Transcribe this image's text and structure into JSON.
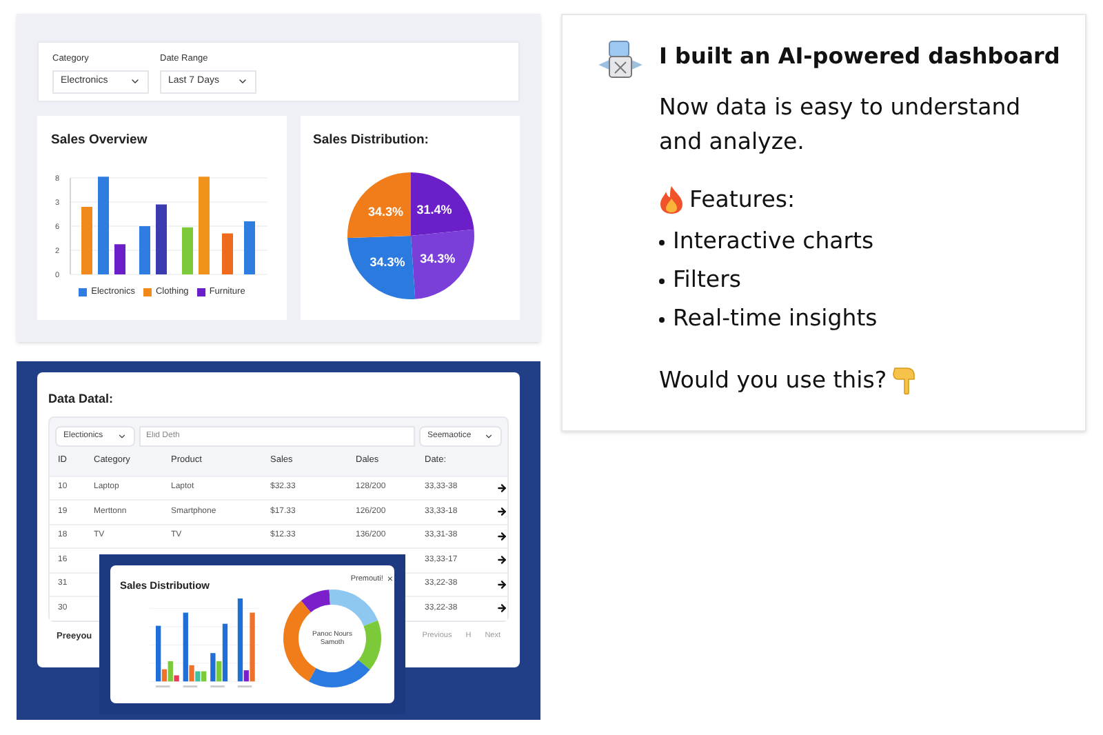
{
  "dashboard": {
    "filters": [
      {
        "label": "Category",
        "value": "Electronics"
      },
      {
        "label": "Date Range",
        "value": "Last 7 Days"
      }
    ],
    "sales_overview": {
      "title": "Sales Overview",
      "axis_labels": [
        "8",
        "3",
        "6",
        "2",
        "0"
      ],
      "legend": [
        {
          "name": "Electronics",
          "color": "#2f7de1"
        },
        {
          "name": "Clothing",
          "color": "#f08a1c"
        },
        {
          "name": "Furniture",
          "color": "#6a1fc9"
        }
      ]
    },
    "sales_distribution": {
      "title": "Sales Distribution:",
      "chart_data": {
        "type": "pie",
        "values": [
          31.4,
          34.3,
          34.3,
          34.3
        ],
        "value_labels": [
          "31.4%",
          "34.3%",
          "34.3%",
          "34.3%"
        ]
      }
    }
  },
  "data_table": {
    "title": "Data Datal:",
    "category_select": "Electionics",
    "search": {
      "placeholder": "Elid Deth"
    },
    "sort_select": "Seemaotice",
    "columns": [
      "ID",
      "Category",
      "Product",
      "Sales",
      "Dales",
      "Date:"
    ],
    "rows": [
      {
        "id": "10",
        "category": "Laptop",
        "product": "Laptot",
        "sales": "$32.33",
        "dales": "128/200",
        "date": "33,33-38"
      },
      {
        "id": "19",
        "category": "Merttonn",
        "product": "Smartphone",
        "sales": "$17.33",
        "dales": "126/200",
        "date": "33,33-18"
      },
      {
        "id": "18",
        "category": "TV",
        "product": "TV",
        "sales": "$12.33",
        "dales": "136/200",
        "date": "33,31-38"
      },
      {
        "id": "16",
        "date": "33,33-17"
      },
      {
        "id": "31",
        "date": "33,22-38"
      },
      {
        "id": "30",
        "date": "33,22-38"
      }
    ],
    "footer_left": "Preeyou",
    "pagination": [
      "Previous",
      "H",
      "Next"
    ]
  },
  "popup": {
    "title": "Sales Distributiow",
    "close_label": "Premouti!",
    "close_icon": "×",
    "donut_center": [
      "Panoc Nours",
      "Samoth"
    ]
  },
  "post": {
    "title": "I built an AI-powered dashboard",
    "intro": "Now data is easy to understand and analyze.",
    "features_heading": "Features:",
    "features": [
      "Interactive charts",
      "Filters",
      "Real-time insights"
    ],
    "question": "Would you use this?"
  }
}
